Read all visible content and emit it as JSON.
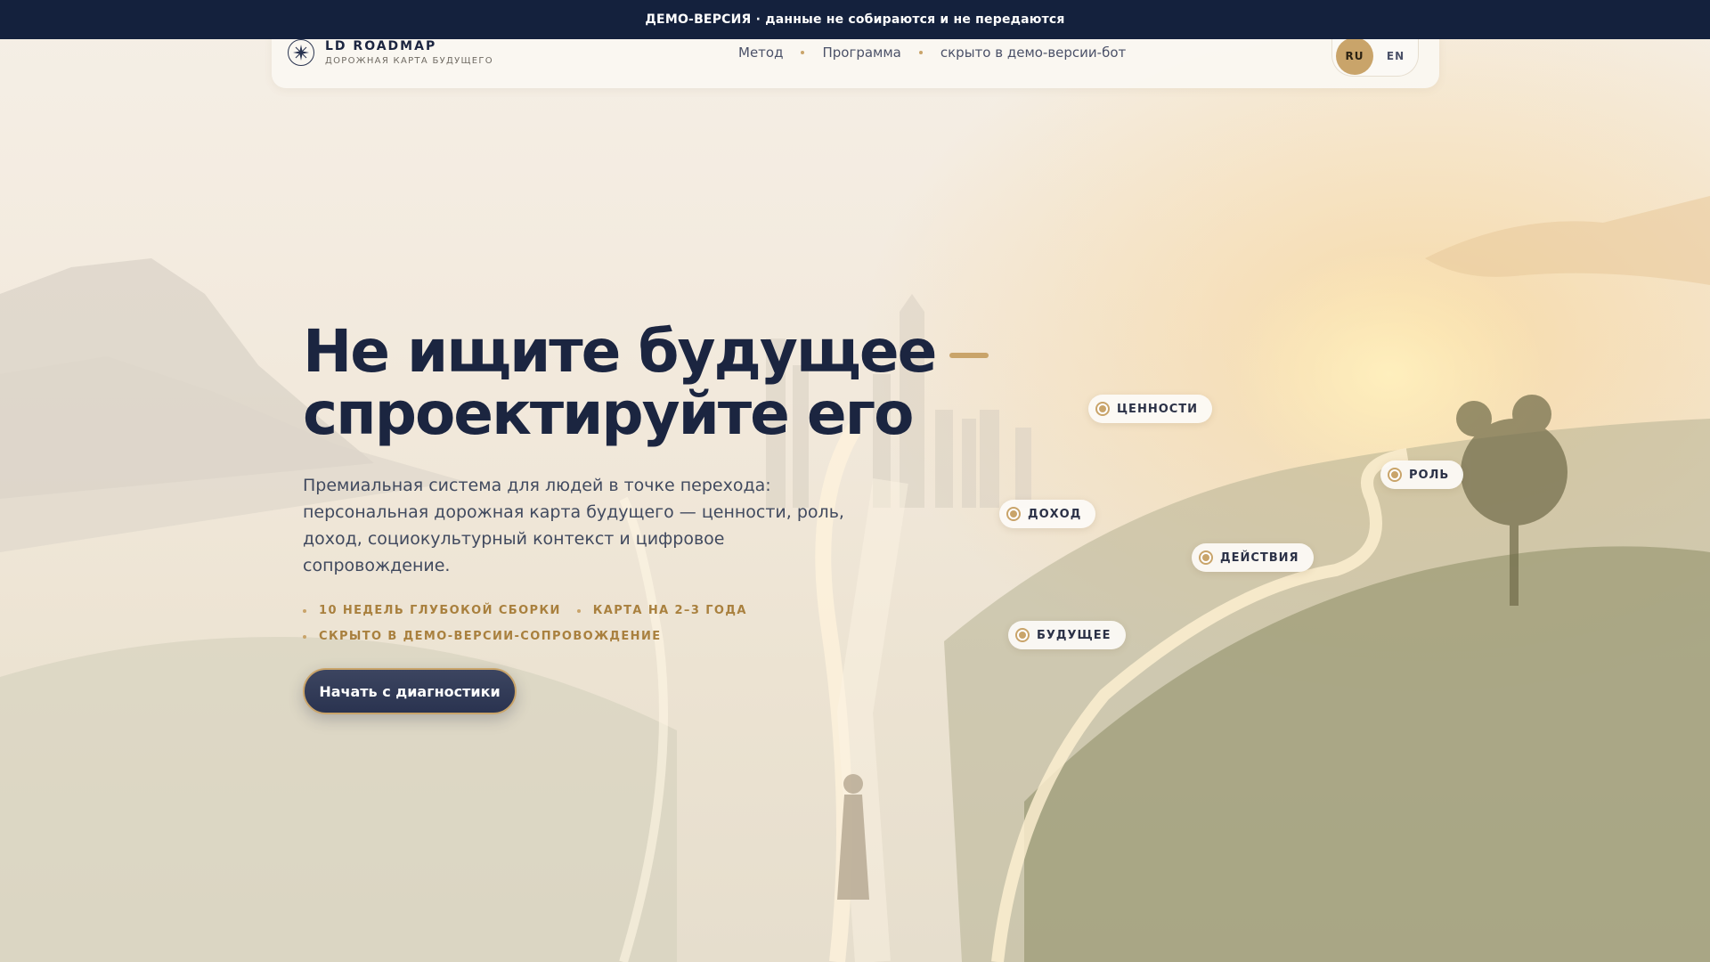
{
  "banner": {
    "text": "ДЕМО-ВЕРСИЯ · данные не собираются и не передаются"
  },
  "brand": {
    "name": "LD ROADMAP",
    "tagline": "ДОРОЖНАЯ КАРТА БУДУЩЕГО",
    "icon": "compass-star-icon"
  },
  "nav": {
    "items": [
      {
        "label": "Метод"
      },
      {
        "label": "Программа"
      },
      {
        "label": "скрыто в демо-версии-бот"
      }
    ]
  },
  "lang": {
    "ru": "RU",
    "en": "EN",
    "active": "RU"
  },
  "hero": {
    "title_line1": "Не ищите будущее",
    "title_line2": "спроектируйте его",
    "subtitle": "Премиальная система для людей в точке перехода: персональная дорожная карта будущего — ценности, роль, доход, социокультурный контекст и цифровое сопровождение.",
    "chips": [
      "10 НЕДЕЛЬ ГЛУБОКОЙ СБОРКИ",
      "КАРТА НА 2–3 ГОДА",
      "СКРЫТО В ДЕМО-ВЕРСИИ-СОПРОВОЖДЕНИЕ"
    ],
    "cta": "Начать с диагностики"
  },
  "path_tags": [
    "ЦЕННОСТИ",
    "РОЛЬ",
    "ДОХОД",
    "ДЕЙСТВИЯ",
    "БУДУЩЕЕ"
  ],
  "colors": {
    "navy": "#14213d",
    "gold": "#c9a46a",
    "ink": "#1b2540"
  }
}
